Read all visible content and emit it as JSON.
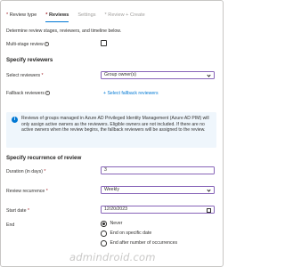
{
  "tabs": [
    {
      "label": "Review type",
      "state": "normal",
      "required": true
    },
    {
      "label": "Reviews",
      "state": "active",
      "required": true
    },
    {
      "label": "Settings",
      "state": "disabled",
      "required": false
    },
    {
      "label": "Review + Create",
      "state": "disabled",
      "required": true
    }
  ],
  "description": "Determine review stages, reviewers, and timeline below.",
  "multistage": {
    "label": "Multi-stage review",
    "checked": false
  },
  "specify_reviewers": {
    "heading": "Specify reviewers",
    "select_label": "Select reviewers",
    "select_value": "Group owner(s)",
    "fallback_label": "Fallback reviewers",
    "fallback_link": "+ Select fallback reviewers"
  },
  "notice": {
    "icon": "info-icon",
    "text": "Reviews of groups managed in Azure AD Privileged Identity Management (Azure AD PIM) will only assign active owners as the reviewers. Eligible owners are not included. If there are no active owners when the review begins, the fallback reviewers will be assigned to the review."
  },
  "recurrence": {
    "heading": "Specify recurrence of review",
    "duration_label": "Duration (in days)",
    "duration_value": "3",
    "recurrence_label": "Review recurrence",
    "recurrence_value": "Weekly",
    "start_label": "Start date",
    "start_value": "12/20/2023",
    "end_label": "End",
    "end_options": [
      {
        "label": "Never",
        "checked": true
      },
      {
        "label": "End on specific date",
        "checked": false
      },
      {
        "label": "End after number of occurrences",
        "checked": false
      }
    ]
  },
  "watermark": "admindroid.com",
  "colors": {
    "accent": "#0078d4",
    "focus": "#8764b8",
    "required": "#a4262c",
    "notice_bg": "#eff6fc"
  }
}
